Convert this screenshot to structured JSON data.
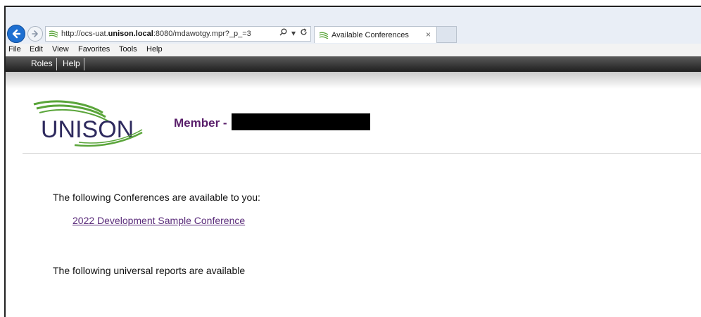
{
  "browser": {
    "url_prefix": "http://ocs-uat.",
    "url_host_bold": "unison.local",
    "url_rest": ":8080/mdawotgy.mpr?_p_=3",
    "search_icon": "search-icon",
    "refresh_icon": "refresh-icon",
    "tab_title": "Available Conferences",
    "tab_close": "×"
  },
  "menu": {
    "file": "File",
    "edit": "Edit",
    "view": "View",
    "favorites": "Favorites",
    "tools": "Tools",
    "help": "Help"
  },
  "appbar": {
    "roles": "Roles",
    "help": "Help"
  },
  "header": {
    "logo_text": "UNISON",
    "member_label": "Member -"
  },
  "content": {
    "conferences_intro": "The following Conferences are available to you:",
    "conference_link": "2022 Development Sample Conference",
    "reports_intro": "The following universal reports are available"
  },
  "colors": {
    "accent_purple": "#5a1f6b",
    "logo_green": "#5aa53a",
    "logo_navy": "#2e2a5e"
  }
}
